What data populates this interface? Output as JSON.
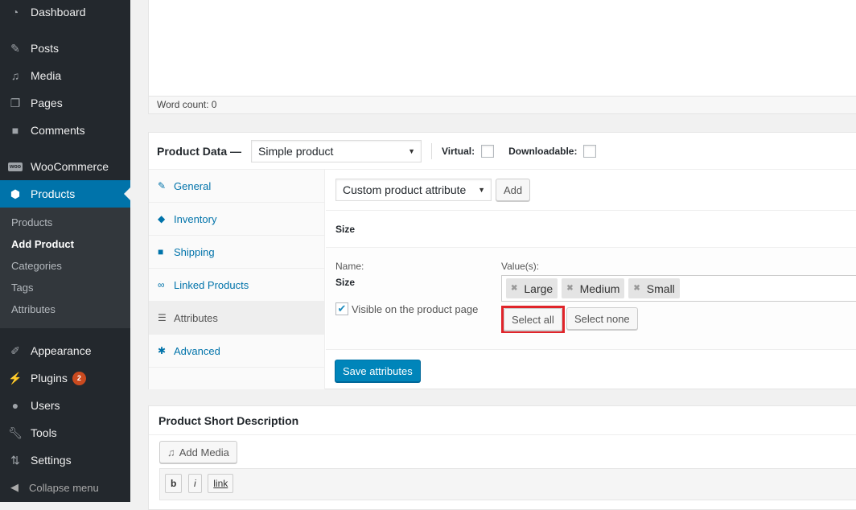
{
  "sidebar": {
    "items": [
      {
        "label": "Dashboard",
        "icon": "dashboard-icon"
      },
      {
        "label": "Posts",
        "icon": "pin-icon"
      },
      {
        "label": "Media",
        "icon": "media-icon"
      },
      {
        "label": "Pages",
        "icon": "pages-icon"
      },
      {
        "label": "Comments",
        "icon": "comment-icon"
      },
      {
        "label": "WooCommerce",
        "icon": "woo-icon"
      },
      {
        "label": "Products",
        "icon": "box-icon"
      },
      {
        "label": "Appearance",
        "icon": "brush-icon"
      },
      {
        "label": "Plugins",
        "icon": "plug-icon",
        "badge": "2"
      },
      {
        "label": "Users",
        "icon": "user-icon"
      },
      {
        "label": "Tools",
        "icon": "wrench-icon"
      },
      {
        "label": "Settings",
        "icon": "settings-icon"
      }
    ],
    "submenu": [
      "Products",
      "Add Product",
      "Categories",
      "Tags",
      "Attributes"
    ],
    "collapse": "Collapse menu"
  },
  "editor": {
    "word_count": "Word count: 0"
  },
  "product_data": {
    "title": "Product Data —",
    "type_select": "Simple product",
    "virtual_label": "Virtual:",
    "downloadable_label": "Downloadable:",
    "tabs": [
      "General",
      "Inventory",
      "Shipping",
      "Linked Products",
      "Attributes",
      "Advanced"
    ],
    "attr_select": "Custom product attribute",
    "add_button": "Add",
    "attribute_heading": "Size",
    "name_label": "Name:",
    "name_value": "Size",
    "values_label": "Value(s):",
    "values": [
      "Large",
      "Medium",
      "Small"
    ],
    "visible_label": "Visible on the product page",
    "select_all": "Select all",
    "select_none": "Select none",
    "save_button": "Save attributes"
  },
  "short_description": {
    "title": "Product Short Description",
    "add_media": "Add Media",
    "qt_buttons": [
      "b",
      "i",
      "link"
    ]
  }
}
